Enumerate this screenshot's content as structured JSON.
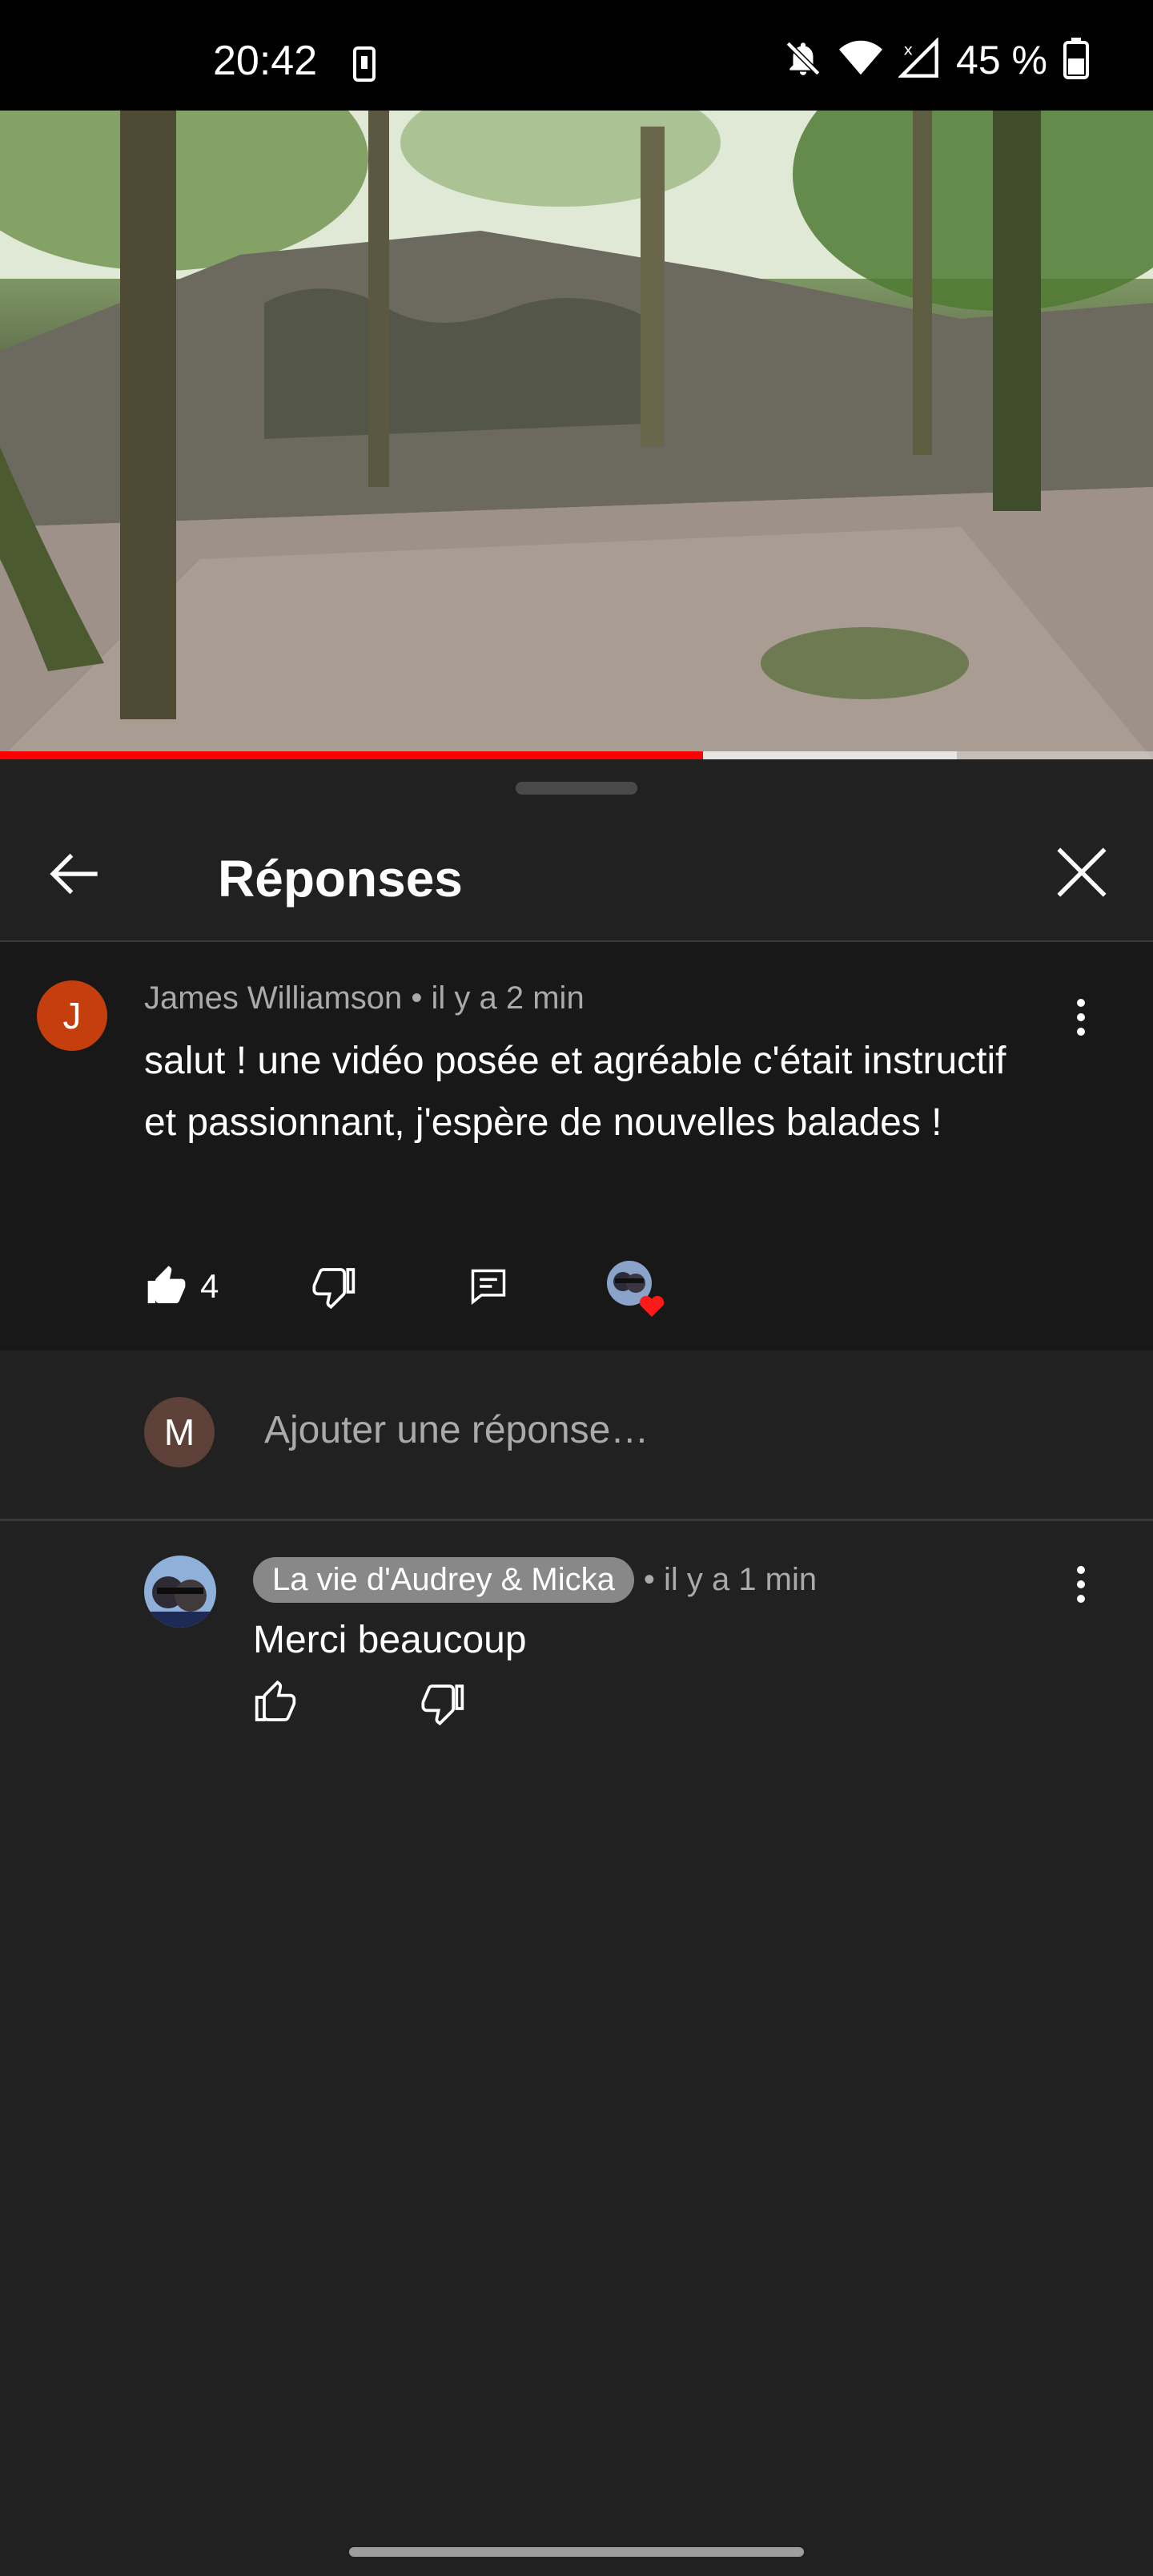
{
  "status_bar": {
    "time": "20:42",
    "battery": "45 %",
    "icons": [
      "phone-screen-icon",
      "bell-off-icon",
      "wifi-icon",
      "cell-signal-icon",
      "battery-icon"
    ]
  },
  "video": {
    "progress_percent": 61,
    "buffered_percent": 83,
    "accent_color": "#ff0000"
  },
  "header": {
    "title": "Réponses",
    "back_icon": "arrow-left-icon",
    "close_icon": "close-icon"
  },
  "parent_comment": {
    "avatar_letter": "J",
    "avatar_color": "#c53f0e",
    "meta": "James Williamson • il y a 2 min",
    "text": "salut ! une vidéo posée et agréable c'était instructif et passionnant, j'espère de nouvelles balades !",
    "like_count": "4",
    "actions": [
      "like-icon",
      "dislike-icon",
      "reply-icon",
      "creator-heart-icon"
    ]
  },
  "reply_input": {
    "avatar_letter": "M",
    "avatar_color": "#5d4037",
    "placeholder": "Ajouter une réponse…"
  },
  "replies": [
    {
      "author": "La vie d'Audrey & Micka",
      "time": "• il y a 1 min",
      "text": "Merci beaucoup",
      "actions": [
        "like-icon",
        "dislike-icon"
      ]
    }
  ]
}
